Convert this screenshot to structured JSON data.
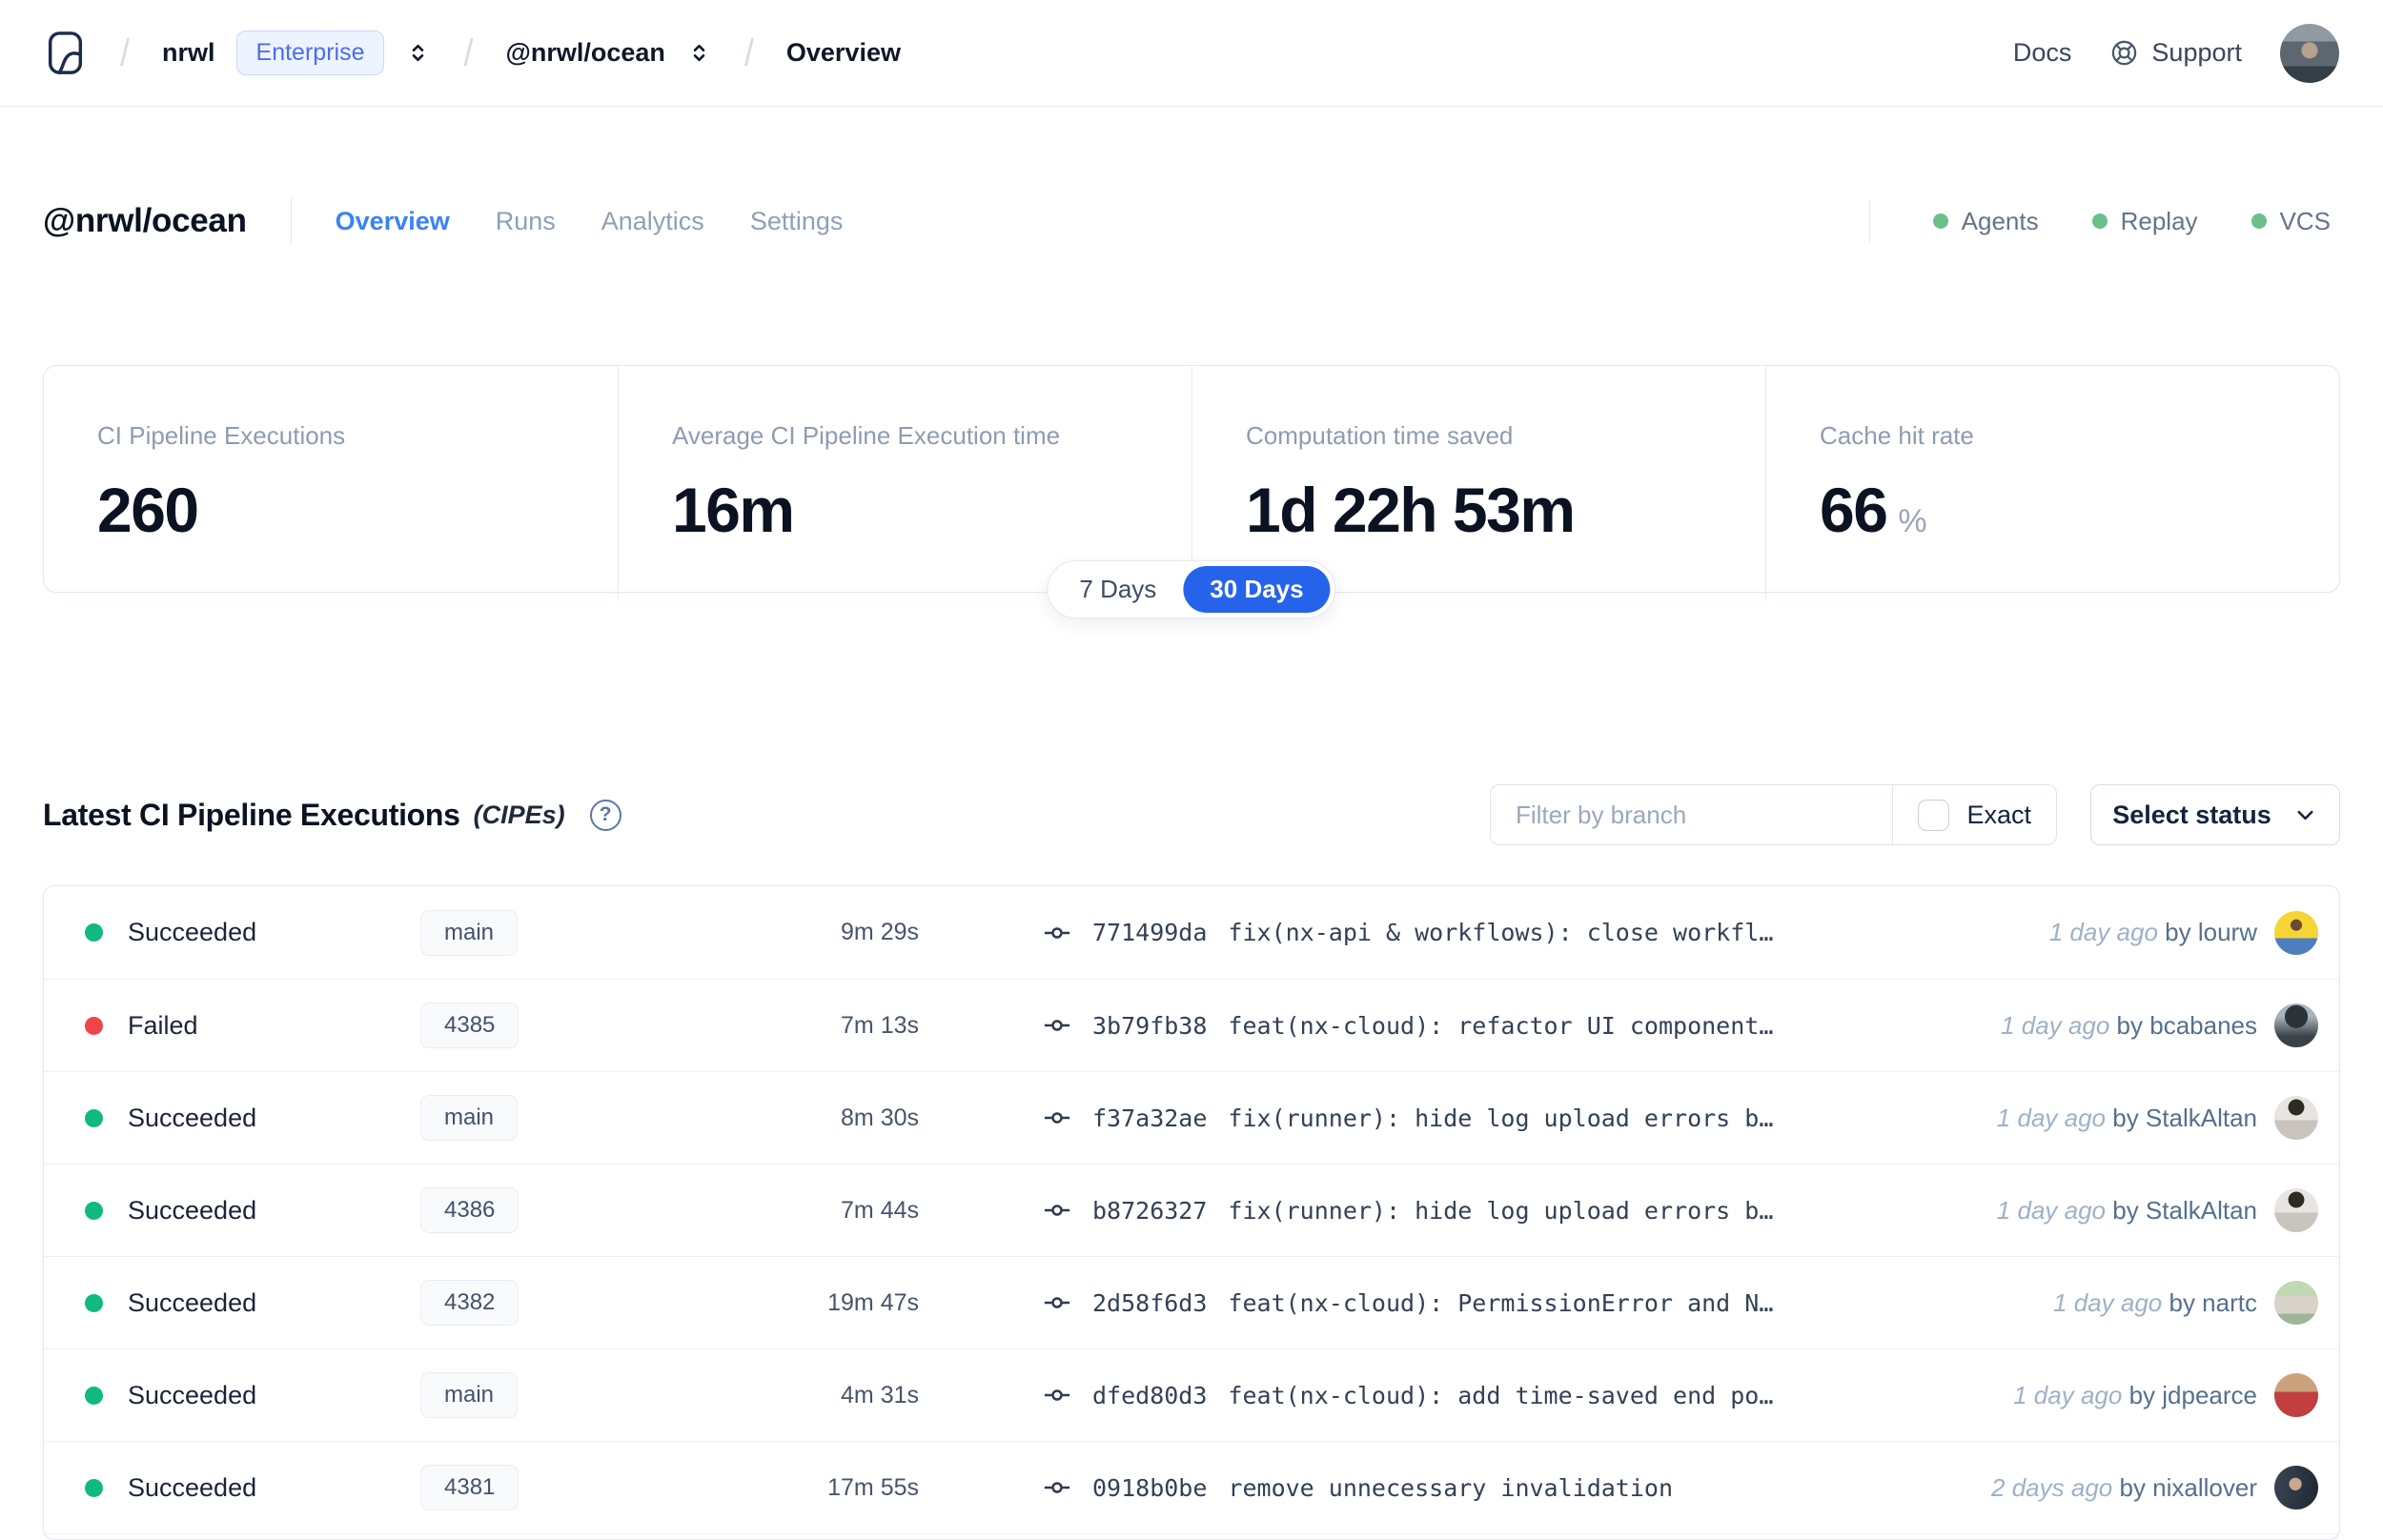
{
  "nav": {
    "separator": "/",
    "org": "nrwl",
    "org_badge": "Enterprise",
    "workspace": "@nrwl/ocean",
    "page": "Overview",
    "docs": "Docs",
    "support": "Support"
  },
  "header": {
    "title": "@nrwl/ocean",
    "tabs": [
      {
        "label": "Overview",
        "state": "active"
      },
      {
        "label": "Runs",
        "state": "inactive"
      },
      {
        "label": "Analytics",
        "state": "inactive"
      },
      {
        "label": "Settings",
        "state": "inactive"
      }
    ],
    "statuses": [
      {
        "label": "Agents"
      },
      {
        "label": "Replay"
      },
      {
        "label": "VCS"
      }
    ]
  },
  "stats": {
    "cards": [
      {
        "label": "CI Pipeline Executions",
        "value": "260",
        "unit": ""
      },
      {
        "label": "Average CI Pipeline Execution time",
        "value": "16m",
        "unit": ""
      },
      {
        "label": "Computation time saved",
        "value": "1d 22h 53m",
        "unit": ""
      },
      {
        "label": "Cache hit rate",
        "value": "66",
        "unit": "%"
      }
    ],
    "range_toggle": {
      "options": [
        {
          "label": "7 Days",
          "state": "inactive"
        },
        {
          "label": "30 Days",
          "state": "active"
        }
      ]
    }
  },
  "section": {
    "title": "Latest CI Pipeline Executions",
    "subtitle": "(CIPEs)",
    "help_glyph": "?",
    "filter_placeholder": "Filter by branch",
    "exact_label": "Exact",
    "exact_checked": false,
    "status_dropdown": "Select status"
  },
  "table": {
    "rows": [
      {
        "status": "Succeeded",
        "status_type": "succeeded",
        "branch": "main",
        "duration": "9m 29s",
        "hash": "771499da",
        "message": "fix(nx-api & workflows): close workfl…",
        "time": "1 day ago",
        "author": "by lourw"
      },
      {
        "status": "Failed",
        "status_type": "failed",
        "branch": "4385",
        "duration": "7m 13s",
        "hash": "3b79fb38",
        "message": "feat(nx-cloud): refactor UI component…",
        "time": "1 day ago",
        "author": "by bcabanes"
      },
      {
        "status": "Succeeded",
        "status_type": "succeeded",
        "branch": "main",
        "duration": "8m 30s",
        "hash": "f37a32ae",
        "message": "fix(runner): hide log upload errors b…",
        "time": "1 day ago",
        "author": "by StalkAltan"
      },
      {
        "status": "Succeeded",
        "status_type": "succeeded",
        "branch": "4386",
        "duration": "7m 44s",
        "hash": "b8726327",
        "message": "fix(runner): hide log upload errors b…",
        "time": "1 day ago",
        "author": "by StalkAltan"
      },
      {
        "status": "Succeeded",
        "status_type": "succeeded",
        "branch": "4382",
        "duration": "19m 47s",
        "hash": "2d58f6d3",
        "message": "feat(nx-cloud): PermissionError and N…",
        "time": "1 day ago",
        "author": "by nartc"
      },
      {
        "status": "Succeeded",
        "status_type": "succeeded",
        "branch": "main",
        "duration": "4m 31s",
        "hash": "dfed80d3",
        "message": "feat(nx-cloud): add time-saved end po…",
        "time": "1 day ago",
        "author": "by jdpearce"
      },
      {
        "status": "Succeeded",
        "status_type": "succeeded",
        "branch": "4381",
        "duration": "17m 55s",
        "hash": "0918b0be",
        "message": "remove unnecessary invalidation",
        "time": "2 days ago",
        "author": "by nixallover"
      }
    ]
  },
  "colors": {
    "accent_tab": "#3b82f6",
    "toggle_pill": "#2563eb",
    "success_dot": "#10b981",
    "failed_dot": "#f04449",
    "health_dot": "#6abf8a",
    "enterprise_text": "#4a6cf6"
  }
}
